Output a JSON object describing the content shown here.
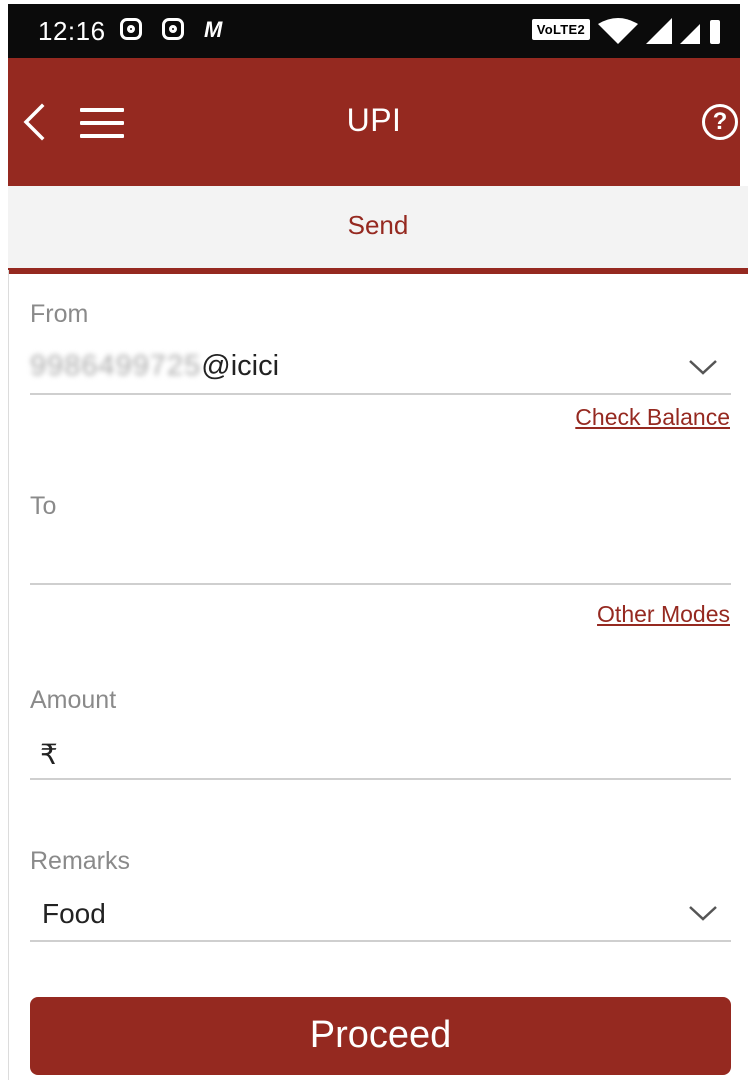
{
  "status_bar": {
    "time": "12:16",
    "left_icons": [
      "instagram-icon",
      "instagram-icon",
      "m-notification-icon"
    ],
    "volte_label": "VoLTE2",
    "right_icons": [
      "wifi-icon",
      "signal-icon",
      "signal-icon",
      "battery-icon"
    ]
  },
  "app_bar": {
    "title": "UPI",
    "back_icon": "chevron-left-icon",
    "menu_icon": "hamburger-menu-icon",
    "help_icon": "help-circle-icon",
    "help_glyph": "?"
  },
  "tabs": {
    "active": "Send"
  },
  "form": {
    "from": {
      "label": "From",
      "value_masked": "9986499725",
      "value_suffix": "@icici",
      "dropdown_icon": "chevron-down-icon"
    },
    "check_balance": "Check Balance",
    "to": {
      "label": "To",
      "value": ""
    },
    "other_modes": "Other Modes",
    "amount": {
      "label": "Amount",
      "currency": "₹",
      "value": ""
    },
    "remarks": {
      "label": "Remarks",
      "value": "Food",
      "dropdown_icon": "chevron-down-icon"
    }
  },
  "actions": {
    "proceed": "Proceed"
  },
  "colors": {
    "brand": "#952920",
    "status_bar": "#0b0b0b",
    "tab_background": "#f3f3f3",
    "label_gray": "#8a8a8a"
  }
}
